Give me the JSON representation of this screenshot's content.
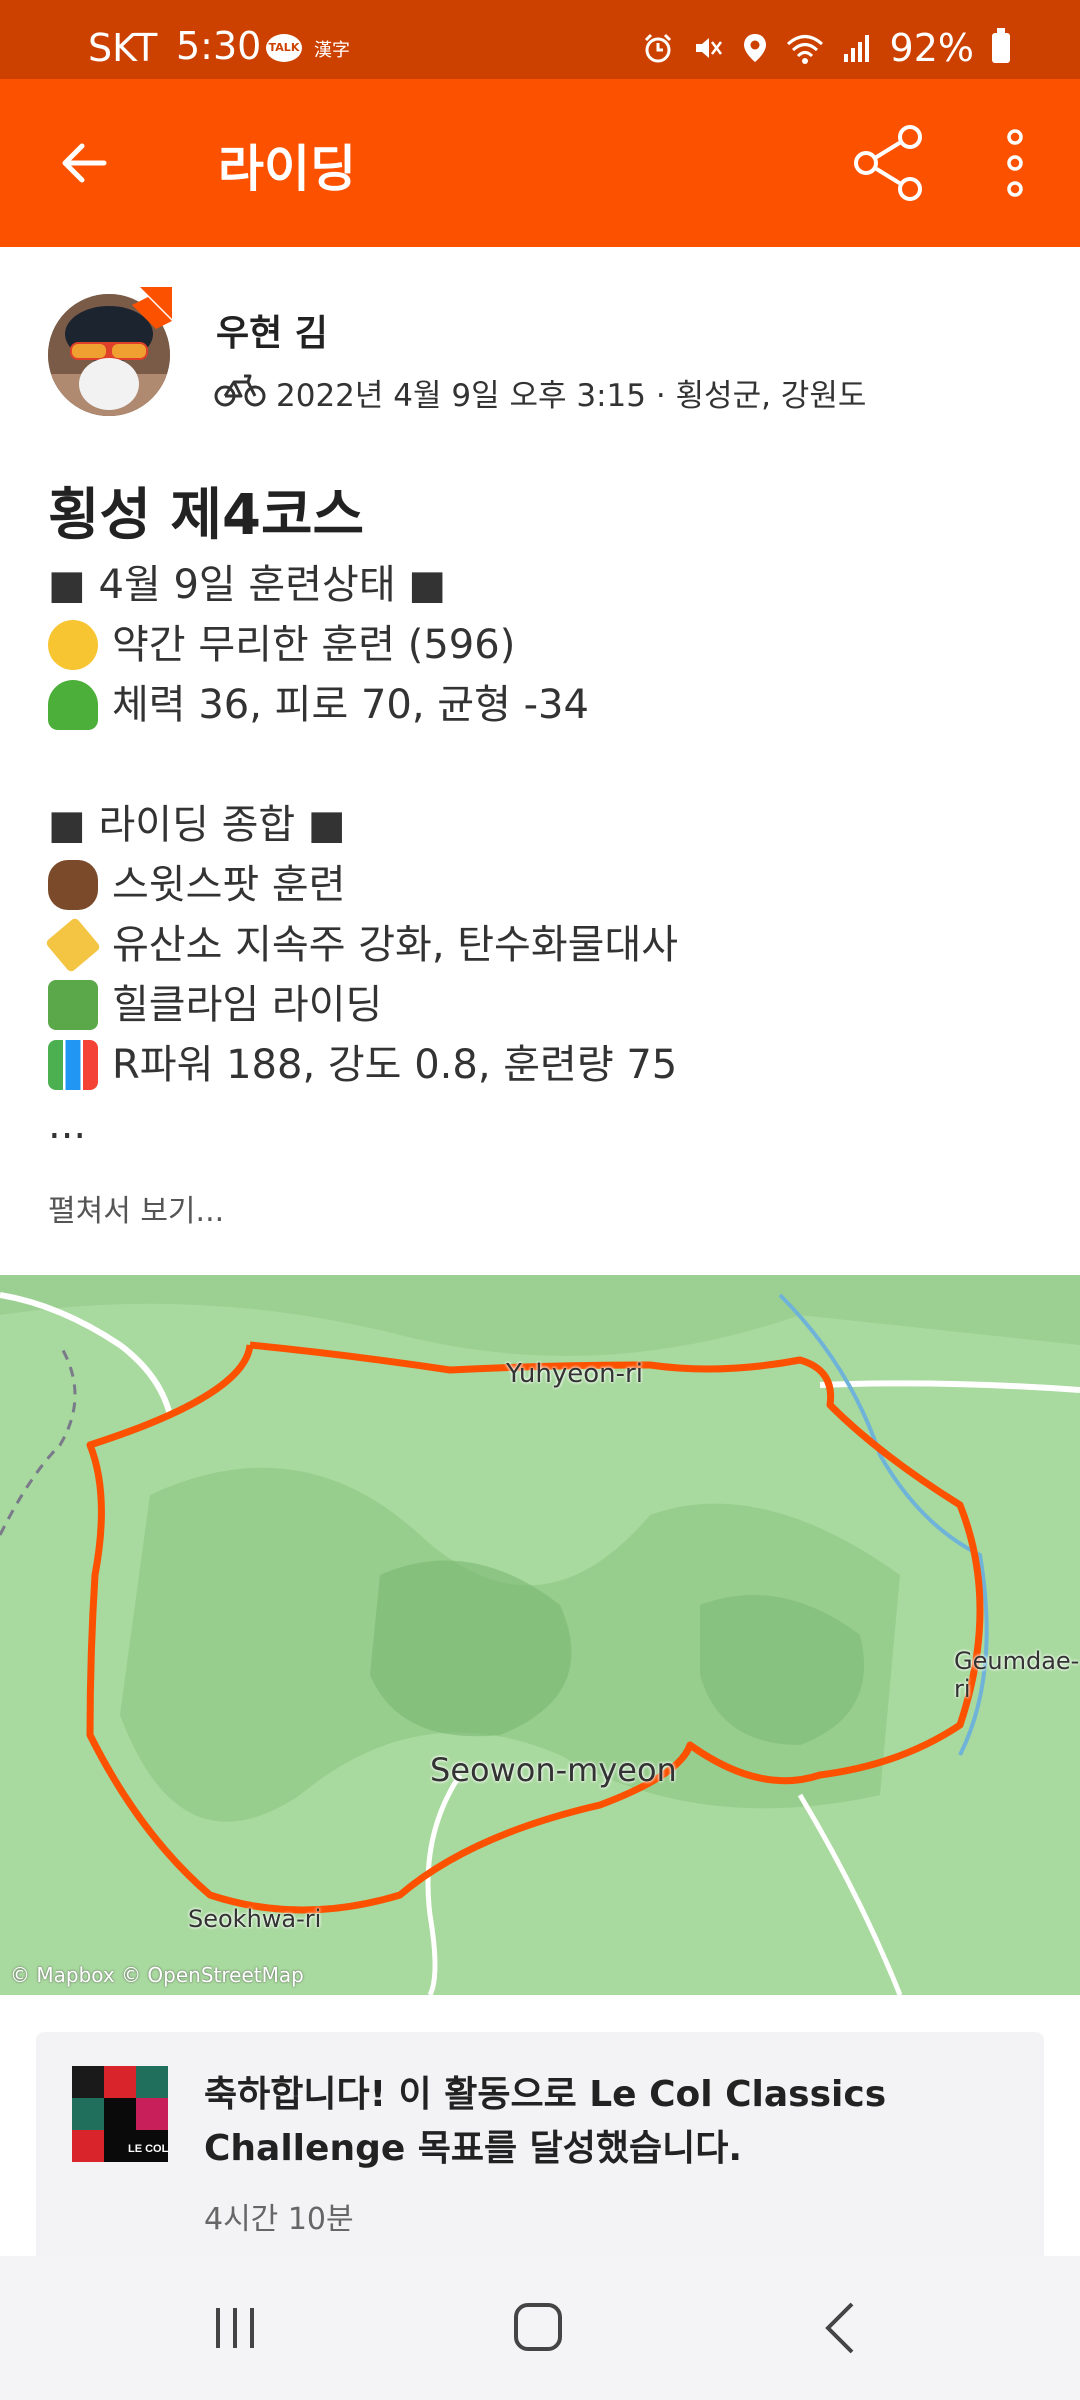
{
  "status_bar": {
    "carrier": "SKT",
    "time": "5:30",
    "talk_badge": "TALK",
    "hanja_indicator": "漢字",
    "battery": "92%"
  },
  "app_bar": {
    "title": "라이딩"
  },
  "activity": {
    "athlete_name": "우현 김",
    "meta": "2022년 4월 9일 오후 3:15 · 횡성군, 강원도",
    "title": "횡성 제4코스",
    "description": [
      {
        "emoji": "",
        "text": "■ 4월 9일 훈련상태 ■"
      },
      {
        "emoji": "grinning-sweat-emoji",
        "text": "약간 무리한 훈련 (596)"
      },
      {
        "emoji": "tree-emoji",
        "text": "체력 36, 피로 70, 균형 -34"
      },
      {
        "emoji": "",
        "text": ""
      },
      {
        "emoji": "",
        "text": "■ 라이딩 종합 ■"
      },
      {
        "emoji": "boar-emoji",
        "text": "스윗스팟 훈련"
      },
      {
        "emoji": "label-tag-emoji",
        "text": "유산소 지속주 강화, 탄수화물대사"
      },
      {
        "emoji": "mountain-biker-emoji",
        "text": "힐클라임 라이딩"
      },
      {
        "emoji": "bar-chart-emoji",
        "text": "R파워 188, 강도 0.8, 훈련량 75"
      },
      {
        "emoji": "",
        "text": "..."
      }
    ],
    "expand_label": "펼쳐서 보기..."
  },
  "map": {
    "labels": {
      "north": "Yuhyeon-ri",
      "east": "Geumdae-ri",
      "center": "Seowon-myeon",
      "southwest": "Seokhwa-ri"
    },
    "attribution": "© Mapbox © OpenStreetMap",
    "route_color": "#fc5200"
  },
  "challenge": {
    "text": "축하합니다! 이 활동으로 Le Col Classics Challenge 목표를 달성했습니다.",
    "time": "4시간 10분",
    "logo_text": "LE COL"
  },
  "colors": {
    "brand": "#fc5200",
    "status_bar": "#cc4100"
  }
}
